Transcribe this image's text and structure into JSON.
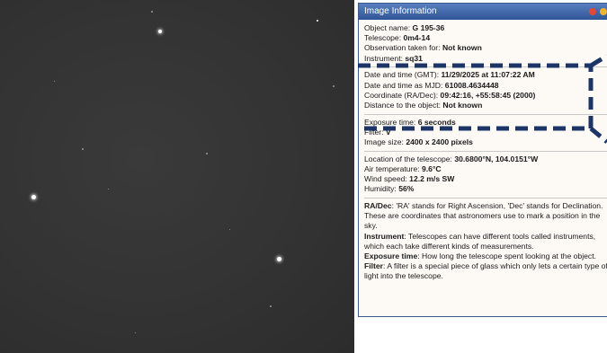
{
  "panel": {
    "title": "Image Information",
    "object_name": {
      "label": "Object name: ",
      "value": "G 195-36"
    },
    "telescope": {
      "label": "Telescope: ",
      "value": "0m4-14"
    },
    "observation_for": {
      "label": "Observation taken for: ",
      "value": "Not known"
    },
    "instrument": {
      "label": "Instrument: ",
      "value": "sq31"
    },
    "date_gmt": {
      "label": "Date and time (GMT): ",
      "value": "11/29/2025 at 11:07:22 AM"
    },
    "date_mjd": {
      "label": "Date and time as MJD: ",
      "value": "61008.4634448"
    },
    "coordinate": {
      "label": "Coordinate (RA/Dec): ",
      "value": "09:42:16, +55:58:45 (2000)"
    },
    "distance": {
      "label": "Distance to the object: ",
      "value": "Not known"
    },
    "exposure": {
      "label": "Exposure time: ",
      "value": "6 seconds"
    },
    "filter": {
      "label": "Filter: ",
      "value": "V"
    },
    "image_size": {
      "label": "Image size: ",
      "value": "2400 x 2400 pixels"
    },
    "location": {
      "label": "Location of the telescope: ",
      "value": "30.6800°N, 104.0151°W"
    },
    "air_temp": {
      "label": "Air temperature: ",
      "value": "9.6°C"
    },
    "wind": {
      "label": "Wind speed: ",
      "value": "12.2 m/s SW"
    },
    "humidity": {
      "label": "Humidity: ",
      "value": "56%"
    },
    "glossary": [
      {
        "term": "RA/Dec",
        "text": ": 'RA' stands for Right Ascension, 'Dec' stands for Declination. These are coordinates that astronomers use to mark a position in the sky."
      },
      {
        "term": "Instrument",
        "text": ": Telescopes can have different tools called instruments, which each take different kinds of measurements."
      },
      {
        "term": "Exposure time",
        "text": ": How long the telescope spent looking at the object."
      },
      {
        "term": "Filter",
        "text": ": A filter is a special piece of glass which only lets a certain type of light into the telescope."
      }
    ]
  },
  "colors": {
    "titlebar": "#2f5597",
    "callout": "#1c3566",
    "sky": "#333333"
  }
}
